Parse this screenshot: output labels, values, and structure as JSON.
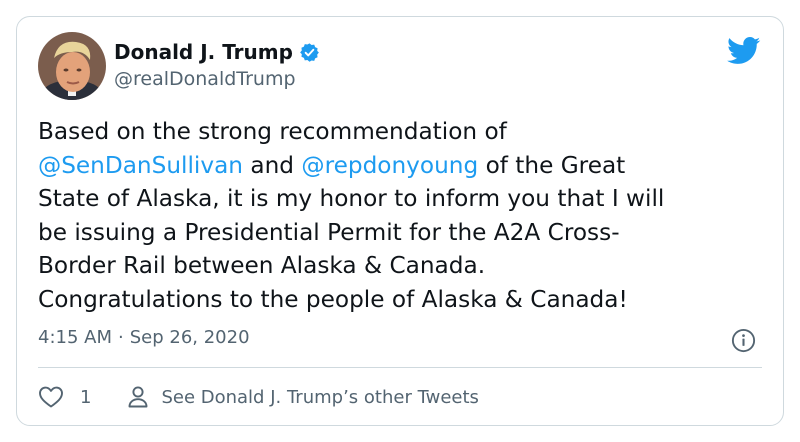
{
  "author": {
    "name": "Donald J. Trump",
    "handle": "@realDonaldTrump",
    "verified": true
  },
  "tweet": {
    "text_before_mention": "Based on the strong recommendation of",
    "mention_1": "@SenDanSullivan",
    "joiner": " and ",
    "mention_2": "@repdonyoung",
    "text_after_mention": " of the Great",
    "line_3": "State of Alaska, it is my honor to inform you that I will",
    "line_4": "be issuing a Presidential Permit for the A2A Cross-",
    "line_5": "Border Rail between Alaska & Canada.",
    "line_6": "Congratulations to the people of Alaska & Canada!"
  },
  "meta": {
    "time": "4:15 AM",
    "separator": "·",
    "date": "Sep 26, 2020"
  },
  "actions": {
    "like_count": "1",
    "other_tweets_label": "See Donald J. Trump’s other Tweets"
  },
  "icons": {
    "brand": "twitter-bird-icon",
    "verified": "verified-badge-icon",
    "info": "info-icon",
    "like": "heart-icon",
    "profile": "person-icon"
  },
  "colors": {
    "accent": "#1d9bf0",
    "text": "#0f1419",
    "secondary": "#536471",
    "border": "#cfd9de"
  }
}
